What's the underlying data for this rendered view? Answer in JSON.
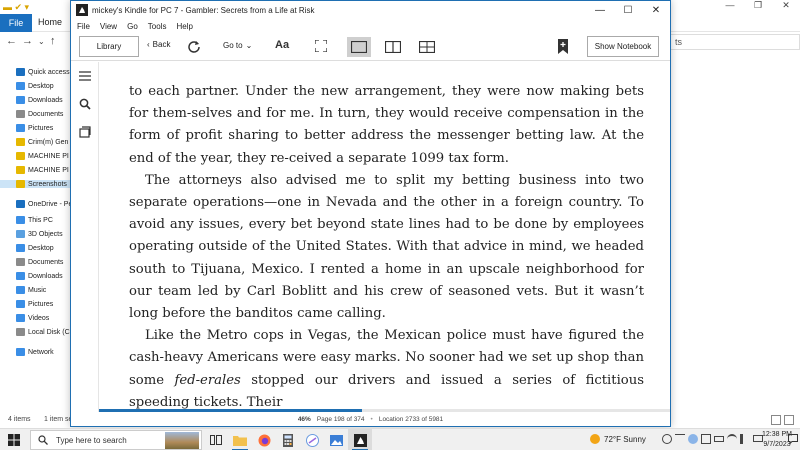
{
  "explorer": {
    "ribbon": {
      "file": "File",
      "home": "Home"
    },
    "nav": [
      {
        "label": "Quick access",
        "color": "#1a6fbf"
      },
      {
        "label": "Desktop",
        "color": "#3a8ee6"
      },
      {
        "label": "Downloads",
        "color": "#3a8ee6"
      },
      {
        "label": "Documents",
        "color": "#8a8a8a"
      },
      {
        "label": "Pictures",
        "color": "#3a8ee6"
      },
      {
        "label": "Crim(m) Gen",
        "color": "#e6b800"
      },
      {
        "label": "MACHINE PI",
        "color": "#e6b800"
      },
      {
        "label": "MACHINE PI",
        "color": "#e6b800"
      },
      {
        "label": "Screenshots",
        "color": "#e6b800",
        "selected": true
      },
      {
        "label": "OneDrive - Pers",
        "color": "#1a6fbf"
      },
      {
        "label": "This PC",
        "color": "#3a8ee6"
      },
      {
        "label": "3D Objects",
        "color": "#5aa0e0"
      },
      {
        "label": "Desktop",
        "color": "#3a8ee6"
      },
      {
        "label": "Documents",
        "color": "#8a8a8a"
      },
      {
        "label": "Downloads",
        "color": "#3a8ee6"
      },
      {
        "label": "Music",
        "color": "#3a8ee6"
      },
      {
        "label": "Pictures",
        "color": "#3a8ee6"
      },
      {
        "label": "Videos",
        "color": "#3a8ee6"
      },
      {
        "label": "Local Disk (C",
        "color": "#8a8a8a"
      },
      {
        "label": "Network",
        "color": "#3a8ee6"
      }
    ],
    "status": {
      "items": "4 items",
      "selected": "1 item se"
    },
    "right_stub": "ts"
  },
  "kindle": {
    "title": "mickey's Kindle for PC 7 - Gambler: Secrets from a Life at Risk",
    "menu": [
      "File",
      "View",
      "Go",
      "Tools",
      "Help"
    ],
    "toolbar": {
      "library": "Library",
      "back": "Back",
      "goto": "Go to",
      "font": "Aa",
      "notebook": "Show Notebook"
    },
    "page": {
      "p1": "to each partner. Under the new arrangement, they were now making bets for them-selves and for me. In turn, they would receive compensation in the form of profit sharing to better address the messenger betting law. At the end of the year, they re-ceived a separate 1099 tax form.",
      "p2": "The attorneys also advised me to split my betting business into two separate operations—one in Nevada and the other in a foreign country. To avoid any issues, every bet beyond state lines had to be done by employees operating outside of the United States. With that advice in mind, we headed south to Tijuana, Mexico. I rented a home in an upscale neighborhood for our team led by Carl Boblitt and his crew of seasoned vets. But it wasn’t long before the banditos came calling.",
      "p3_a": "Like the Metro cops in Vegas, the Mexican police must have figured the cash-heavy Americans were easy marks. No sooner had we set up shop than some ",
      "p3_em": "fed-erales",
      "p3_b": " stopped our drivers and issued a series of fictitious speeding tickets. Their"
    },
    "footer": {
      "percent": "46%",
      "page": "Page 198 of 374",
      "location": "Location 2733 of 5981"
    },
    "progress_fraction": 0.46,
    "accent": "#1f6fb2"
  },
  "taskbar": {
    "search_placeholder": "Type here to search",
    "weather": "72°F  Sunny",
    "time": "12:38 PM",
    "date": "9/7/2023"
  }
}
